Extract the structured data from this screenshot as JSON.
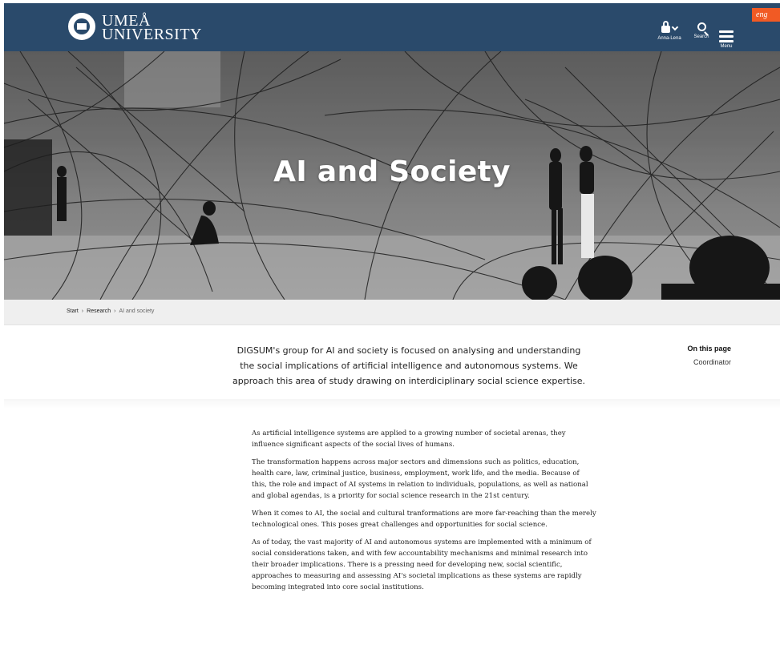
{
  "header": {
    "logo_line1": "UMEÅ",
    "logo_line2": "UNIVERSITY",
    "login_label": "Anna-Lena",
    "search_label": "Search",
    "menu_label": "Menu",
    "lang_tab": "eng",
    "brand_color": "#2a4a6b",
    "accent_color": "#f15a24"
  },
  "hero": {
    "title": "AI and Society"
  },
  "breadcrumb": {
    "items": [
      "Start",
      "Research",
      "AI and society"
    ]
  },
  "intro": {
    "text": "DIGSUM's group for AI and society is focused on analysing and understanding the social implications of artificial intelligence and autonomous systems. We approach this area of study drawing on interdiciplinary social science expertise."
  },
  "toc": {
    "title": "On this page",
    "links": [
      "Coordinator"
    ]
  },
  "body": {
    "paragraphs": [
      "As artificial intelligence systems are applied to a growing number of societal arenas, they influence significant aspects of the social lives of humans.",
      "The transformation happens across major sectors and dimensions such as politics, education, health care, law, criminal justice, business, employment, work life, and the media. Because of this, the role and impact of AI systems in relation to individuals, populations, as well as national and global agendas, is a priority for social science research in the 21st century.",
      "When it comes to AI, the social and cultural tranformations are more far-reaching than the merely technological ones. This poses great challenges and opportunities for social science.",
      "As of today, the vast majority of AI and autonomous systems are implemented with a minimum of social considerations taken, and with few accountability mechanisms and minimal research into their broader implications. There is a pressing need for developing new, social scientific, approaches to measuring and assessing AI's societal implications as these systems are rapidly becoming integrated into core social institutions."
    ]
  }
}
